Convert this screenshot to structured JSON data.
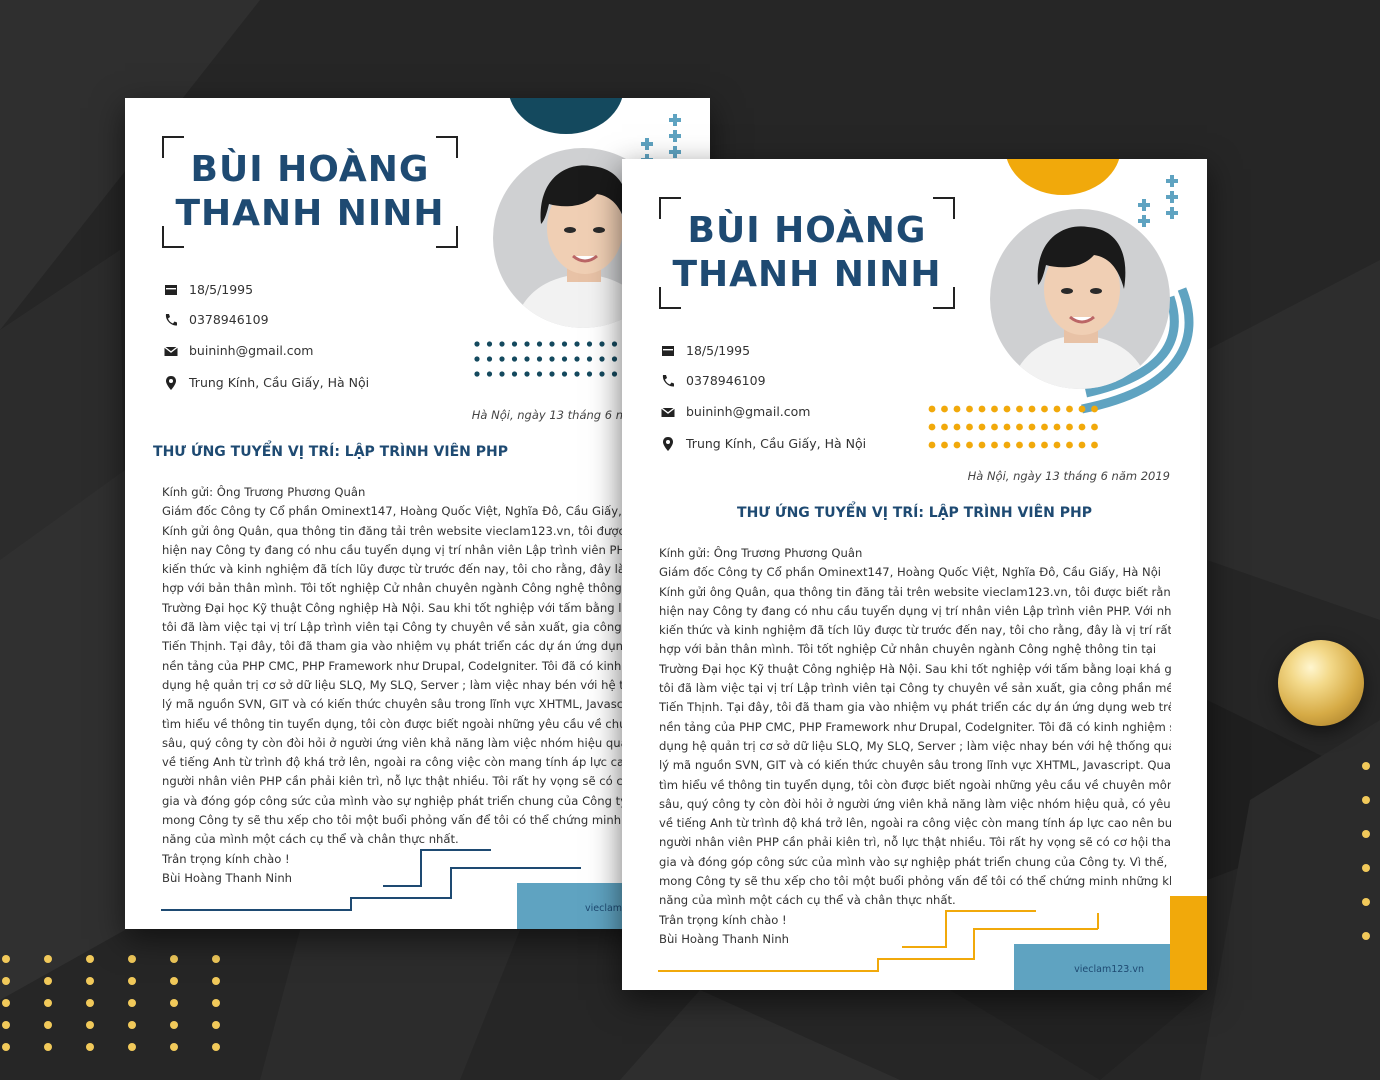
{
  "cv": {
    "name_line1": "BÙI HOÀNG",
    "name_line2": "THANH NINH",
    "contacts": [
      {
        "icon": "calendar-icon",
        "text": "18/5/1995"
      },
      {
        "icon": "phone-icon",
        "text": "0378946109"
      },
      {
        "icon": "email-icon",
        "text": "buininh@gmail.com"
      },
      {
        "icon": "location-pin-icon",
        "text": "Trung Kính, Cầu Giấy, Hà Nội"
      }
    ],
    "date_line": "Hà Nội, ngày 13 tháng 6 năm 2019",
    "date_line_cropped": "Hà Nội, ngày 13 tháng 6 n",
    "position_title": "THƯ ỨNG TUYỂN VỊ TRÍ: LẬP TRÌNH VIÊN PHP",
    "letter_lines": [
      "Kính gửi: Ông Trương Phương Quân",
      "Giám đốc Công ty Cổ phần Ominext147, Hoàng Quốc Việt, Nghĩa Đô, Cầu Giấy, Hà Nội",
      "Kính gửi ông Quân, qua thông tin đăng tải trên website vieclam123.vn, tôi được biết rằng,",
      "hiện nay Công ty đang có nhu cầu tuyển dụng vị trí nhân viên Lập trình viên PHP. Với những",
      "kiến thức và kinh nghiệm đã tích lũy được từ trước đến nay, tôi cho rằng, đây là vị trí rất phù",
      "hợp với bản thân mình. Tôi tốt nghiệp Cử nhân chuyên ngành Công nghệ thông tin tại",
      "Trường Đại học Kỹ thuật Công nghiệp Hà Nội. Sau khi tốt nghiệp với tấm bằng loại khá giỏi.",
      "tôi đã làm việc tại vị trí Lập trình viên tại Công ty chuyên về sản xuất, gia công phần mềm",
      "Tiến Thịnh. Tại đây, tôi đã tham gia vào nhiệm vụ phát triển các dự án ứng dụng web trên",
      "nền tảng của PHP CMC, PHP Framework như Drupal, CodeIgniter. Tôi đã có kinh nghiệm sử",
      "dụng hệ quản trị cơ sở dữ liệu SLQ, My SLQ, Server ; làm việc nhay bén với hệ thống quản",
      "lý mã nguồn SVN, GIT và có kiến thức chuyên sâu trong lĩnh vực XHTML, Javascript. Qua",
      "tìm hiểu về thông tin tuyển dụng, tôi còn được biết ngoài những yêu cầu về chuyên môn",
      "sâu, quý công ty còn đòi hỏi ở người ứng viên khả năng làm việc nhóm hiệu quả, có yêu cầu",
      "về tiếng Anh từ trình độ khá trở lên, ngoài ra công việc còn mang tính áp lực cao nên buộc",
      "người nhân viên PHP cần phải kiên trì, nỗ lực thật nhiều. Tôi rất hy vọng sẽ có cơ hội tham",
      "gia và đóng góp công sức của mình vào sự nghiệp phát triển chung của Công ty. Vì thế, rất",
      "mong Công ty sẽ thu xếp cho tôi một buổi phỏng vấn để tôi có thể chứng minh những khả",
      "năng của mình một cách cụ thể và chân thực nhất.",
      "Trân trọng kính chào !",
      "Bùi Hoàng Thanh Ninh"
    ],
    "website": "vieclam123.vn",
    "website_cropped": "vieclam1"
  },
  "colors": {
    "page_background": "#262626",
    "name_blue": "#1e4a72",
    "back_accent": "#14495e",
    "front_accent": "#f1a90b",
    "footer_blue": "#5fa3c1",
    "gold_dots": "#f1c95a"
  }
}
